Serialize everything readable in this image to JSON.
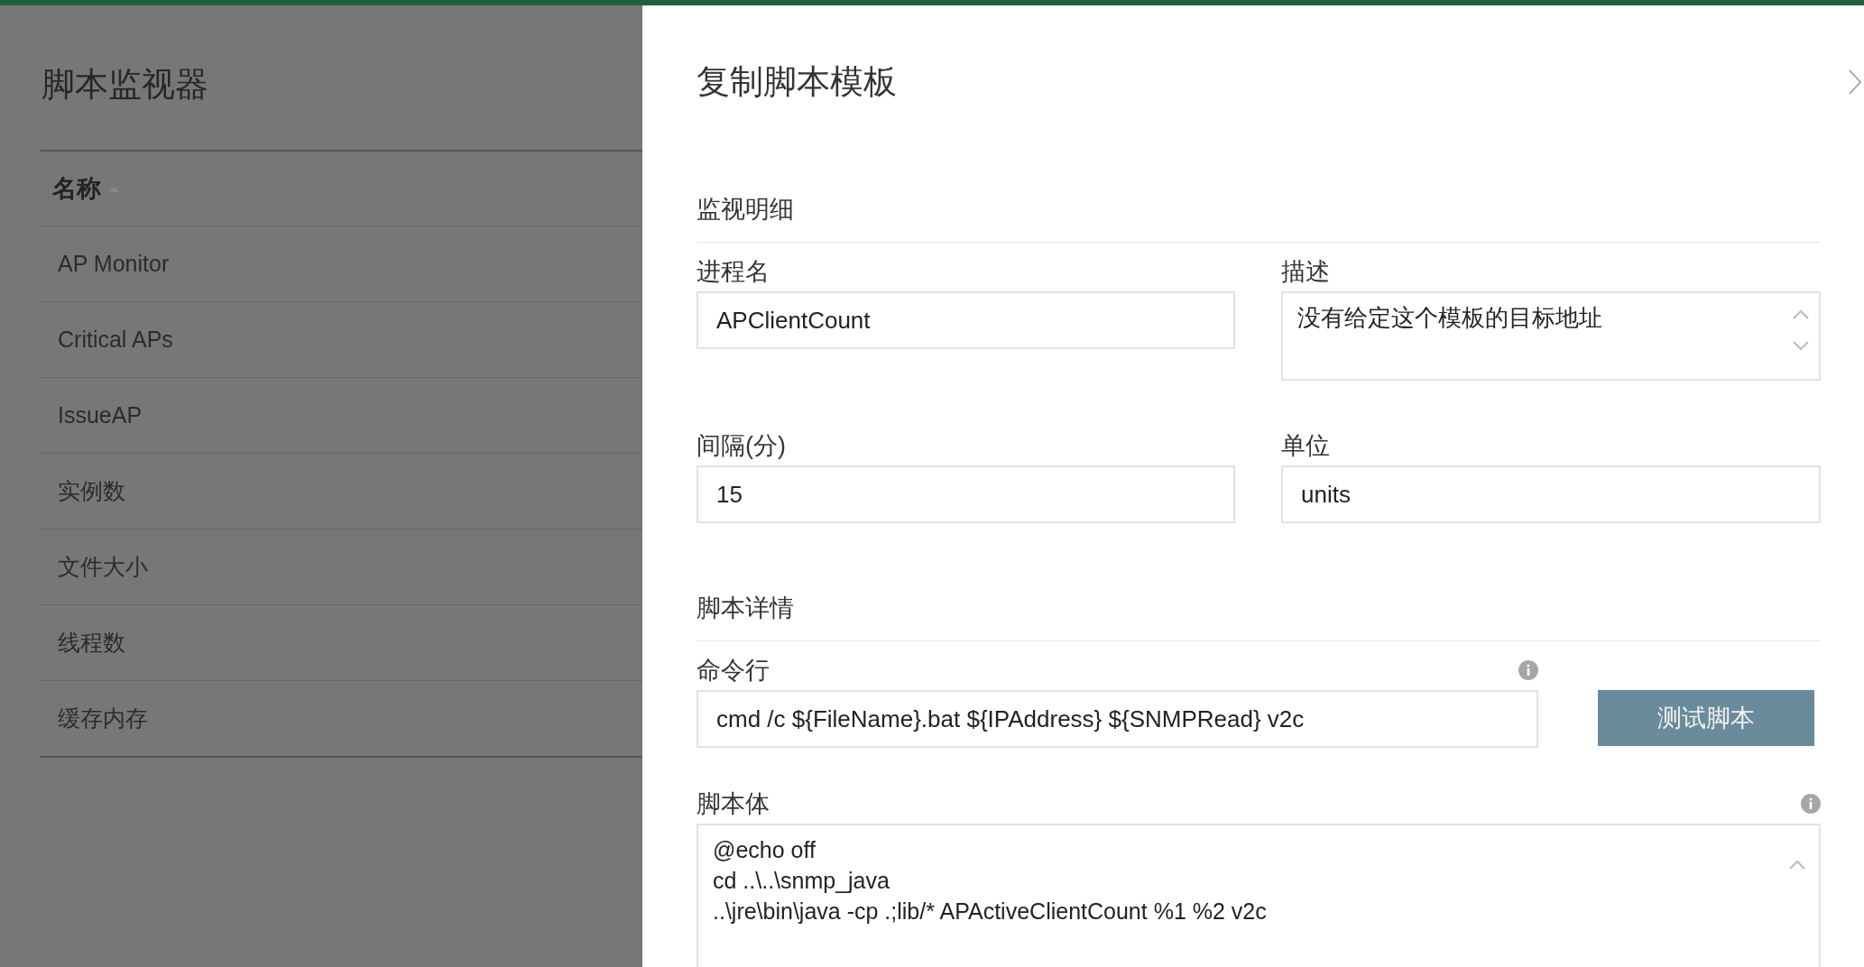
{
  "list_panel": {
    "title": "脚本监视器",
    "column": {
      "label": "名称",
      "sort_ascending": true
    },
    "rows": [
      {
        "name": "AP Monitor"
      },
      {
        "name": "Critical APs"
      },
      {
        "name": "IssueAP"
      },
      {
        "name": "实例数"
      },
      {
        "name": "文件大小"
      },
      {
        "name": "线程数"
      },
      {
        "name": "缓存内存"
      }
    ]
  },
  "dialog": {
    "title": "复制脚本模板",
    "sections": [
      {
        "heading": "监视明细",
        "fields": [
          {
            "kind": "input",
            "label": "进程名",
            "value": "APClientCount"
          },
          {
            "kind": "textarea",
            "label": "描述",
            "value": "没有给定这个模板的目标地址"
          },
          {
            "kind": "input",
            "label": "间隔(分)",
            "value": "15"
          },
          {
            "kind": "input",
            "label": "单位",
            "value": "units"
          }
        ]
      },
      {
        "heading": "脚本详情",
        "fields": [
          {
            "kind": "command",
            "label": "命令行",
            "value": "cmd /c ${FileName}.bat ${IPAddress} ${SNMPRead} v2c",
            "button": "测试脚本"
          },
          {
            "kind": "script",
            "label": "脚本体",
            "value": "@echo off\ncd ..\\..\\snmp_java\n..\\jre\\bin\\java -cp .;lib/* APActiveClientCount %1 %2 v2c"
          }
        ]
      }
    ]
  }
}
